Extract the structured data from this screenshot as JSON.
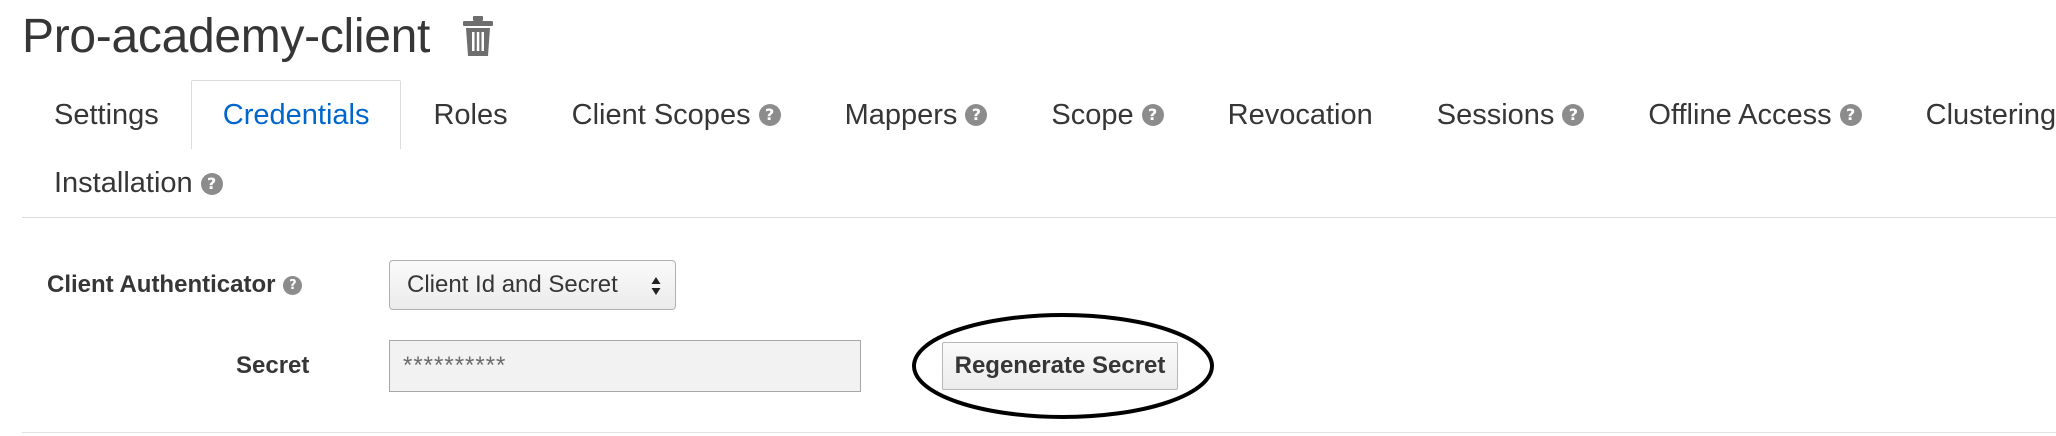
{
  "page": {
    "title": "Pro-academy-client",
    "delete_icon": "trash-icon"
  },
  "tabs": {
    "items": [
      {
        "label": "Settings",
        "help": false,
        "active": false
      },
      {
        "label": "Credentials",
        "help": false,
        "active": true
      },
      {
        "label": "Roles",
        "help": false,
        "active": false
      },
      {
        "label": "Client Scopes",
        "help": true,
        "active": false
      },
      {
        "label": "Mappers",
        "help": true,
        "active": false
      },
      {
        "label": "Scope",
        "help": true,
        "active": false
      },
      {
        "label": "Revocation",
        "help": false,
        "active": false
      },
      {
        "label": "Sessions",
        "help": true,
        "active": false
      },
      {
        "label": "Offline Access",
        "help": true,
        "active": false
      },
      {
        "label": "Clustering",
        "help": false,
        "active": false
      },
      {
        "label": "Installation",
        "help": true,
        "active": false
      }
    ],
    "help_glyph": "?",
    "active_color": "#0066cc"
  },
  "form": {
    "authenticator": {
      "label": "Client Authenticator",
      "selected": "Client Id and Secret",
      "help_glyph": "?"
    },
    "secret": {
      "label": "Secret",
      "value": "**********"
    },
    "regenerate_label": "Regenerate Secret"
  }
}
